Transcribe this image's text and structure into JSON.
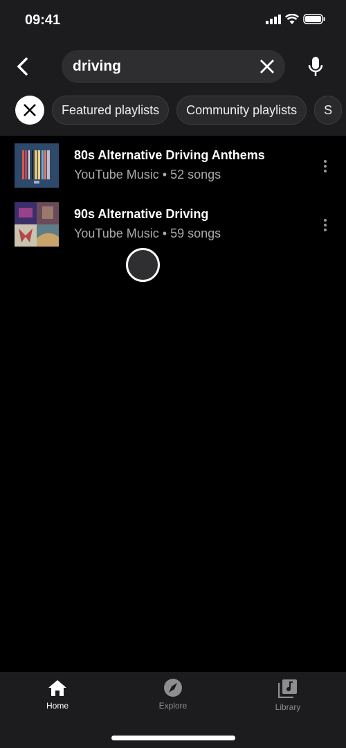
{
  "status_bar": {
    "time": "09:41"
  },
  "search": {
    "query": "driving"
  },
  "chips": [
    "Featured playlists",
    "Community playlists",
    "S"
  ],
  "results": [
    {
      "title": "80s Alternative Driving Anthems",
      "source": "YouTube Music",
      "separator": "•",
      "count": "52 songs"
    },
    {
      "title": "90s Alternative Driving",
      "source": "YouTube Music",
      "separator": "•",
      "count": "59 songs"
    }
  ],
  "nav": {
    "home": "Home",
    "explore": "Explore",
    "library": "Library",
    "active": "home"
  },
  "colors": {
    "header_bg": "#1c1b1d",
    "active": "#ffffff",
    "inactive": "#8e8e90"
  }
}
